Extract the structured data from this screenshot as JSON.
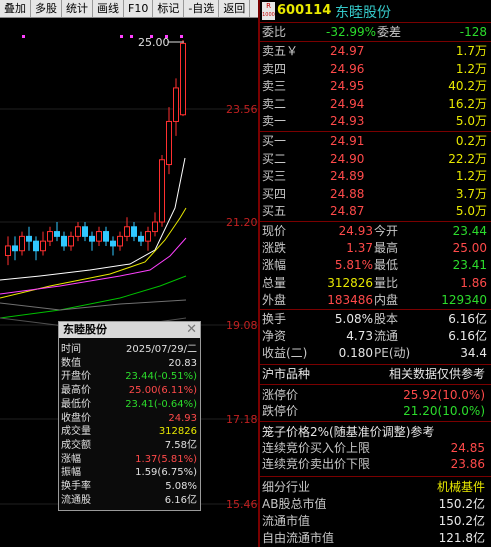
{
  "toolbar": {
    "buttons": [
      "叠加",
      "多股",
      "统计",
      "画线",
      "F10",
      "标记",
      "-自选",
      "返回"
    ]
  },
  "chart": {
    "price_labels": [
      "23.56",
      "21.20",
      "19.08",
      "17.18",
      "15.46"
    ],
    "high_label": "25.00",
    "colors": {
      "up": "#ff3030",
      "down": "#30c8ff",
      "ma1": "#ffffff",
      "ma2": "#e8e800",
      "ma3": "#ff40ff",
      "ma4": "#00c000"
    }
  },
  "infobox": {
    "title": "东睦股份",
    "close_icon": "close-icon",
    "rows": [
      {
        "label": "时间",
        "value": "2025/07/29/二",
        "color": "white"
      },
      {
        "label": "数值",
        "value": "20.83",
        "color": "white"
      },
      {
        "label": "开盘价",
        "value": "23.44(-0.51%)",
        "color": "green"
      },
      {
        "label": "最高价",
        "value": "25.00(6.11%)",
        "color": "red"
      },
      {
        "label": "最低价",
        "value": "23.41(-0.64%)",
        "color": "green"
      },
      {
        "label": "收盘价",
        "value": "24.93",
        "color": "red"
      },
      {
        "label": "成交量",
        "value": "312826",
        "color": "yellow"
      },
      {
        "label": "成交额",
        "value": "7.58亿",
        "color": "white"
      },
      {
        "label": "涨幅",
        "value": "1.37(5.81%)",
        "color": "red"
      },
      {
        "label": "振幅",
        "value": "1.59(6.75%)",
        "color": "white"
      },
      {
        "label": "换手率",
        "value": "5.08%",
        "color": "white"
      },
      {
        "label": "流通股",
        "value": "6.16亿",
        "color": "white"
      }
    ]
  },
  "quote": {
    "badge_top": "R",
    "badge_bottom": "1000",
    "code": "600114",
    "name": "东睦股份",
    "weibi_label": "委比",
    "weibi_value": "-32.99%",
    "weicha_label": "委差",
    "weicha_value": "-128",
    "asks": [
      {
        "label": "卖五￥",
        "price": "24.97",
        "vol": "1.7万"
      },
      {
        "label": "卖四",
        "price": "24.96",
        "vol": "1.2万"
      },
      {
        "label": "卖三",
        "price": "24.95",
        "vol": "40.2万"
      },
      {
        "label": "卖二",
        "price": "24.94",
        "vol": "16.2万"
      },
      {
        "label": "卖一",
        "price": "24.93",
        "vol": "5.0万"
      }
    ],
    "bids": [
      {
        "label": "买一",
        "price": "24.91",
        "vol": "0.2万"
      },
      {
        "label": "买二",
        "price": "24.90",
        "vol": "22.2万"
      },
      {
        "label": "买三",
        "price": "24.89",
        "vol": "1.2万"
      },
      {
        "label": "买四",
        "price": "24.88",
        "vol": "3.7万"
      },
      {
        "label": "买五",
        "price": "24.87",
        "vol": "5.0万"
      }
    ],
    "stats": [
      {
        "l1": "现价",
        "v1": "24.93",
        "c1": "red",
        "l2": "今开",
        "v2": "23.44",
        "c2": "green"
      },
      {
        "l1": "涨跌",
        "v1": "1.37",
        "c1": "red",
        "l2": "最高",
        "v2": "25.00",
        "c2": "red"
      },
      {
        "l1": "涨幅",
        "v1": "5.81%",
        "c1": "red",
        "l2": "最低",
        "v2": "23.41",
        "c2": "green"
      },
      {
        "l1": "总量",
        "v1": "312826",
        "c1": "yellow",
        "l2": "量比",
        "v2": "1.86",
        "c2": "red"
      },
      {
        "l1": "外盘",
        "v1": "183486",
        "c1": "red",
        "l2": "内盘",
        "v2": "129340",
        "c2": "green"
      }
    ],
    "fin": [
      {
        "l1": "换手",
        "v1": "5.08%",
        "l2": "股本",
        "v2": "6.16亿"
      },
      {
        "l1": "净资",
        "v1": "4.73",
        "l2": "流通",
        "v2": "6.16亿"
      },
      {
        "l1": "收益(二)",
        "v1": "0.180",
        "l2": "PE(动)",
        "v2": "34.4"
      }
    ],
    "market_label": "沪市品种",
    "market_note": "相关数据仅供参考",
    "limit_up_label": "涨停价",
    "limit_up_value": "25.92(10.0%)",
    "limit_down_label": "跌停价",
    "limit_down_value": "21.20(10.0%)",
    "cage_text": "笼子价格2%(随基准价调整)参考",
    "buy_limit_label": "连续竞价买入价上限",
    "buy_limit_value": "24.85",
    "sell_limit_label": "连续竞价卖出价下限",
    "sell_limit_value": "23.86",
    "industry_label": "细分行业",
    "industry_value": "机械基件",
    "ab_label": "AB股总市值",
    "ab_value": "150.2亿",
    "float_label": "流通市值",
    "float_value": "150.2亿",
    "free_label": "自由流通市值",
    "free_value": "121.8亿"
  }
}
